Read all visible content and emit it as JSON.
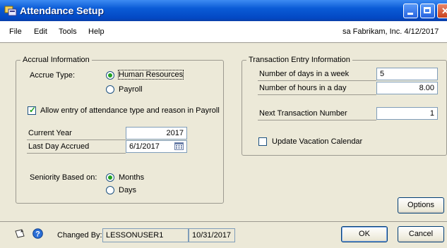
{
  "window": {
    "title": "Attendance Setup"
  },
  "menu": {
    "items": [
      "File",
      "Edit",
      "Tools",
      "Help"
    ],
    "company_info": "sa  Fabrikam, Inc.  4/12/2017"
  },
  "accrual": {
    "legend": "Accrual Information",
    "accrue_type_label": "Accrue Type:",
    "option_hr": "Human Resources",
    "option_payroll": "Payroll",
    "accrue_type_selected": "Human Resources",
    "allow_entry_label": "Allow entry of attendance type and reason in Payroll",
    "allow_entry_checked": true,
    "current_year_label": "Current Year",
    "current_year_value": "2017",
    "last_day_label": "Last Day Accrued",
    "last_day_value": "6/1/2017",
    "seniority_label": "Seniority Based on:",
    "option_months": "Months",
    "option_days": "Days",
    "seniority_selected": "Months"
  },
  "transaction": {
    "legend": "Transaction Entry Information",
    "days_week_label": "Number of days in a week",
    "days_week_value": "5",
    "hours_day_label": "Number of hours in a day",
    "hours_day_value": "8.00",
    "next_txn_label": "Next Transaction Number",
    "next_txn_value": "1",
    "update_vacation_label": "Update Vacation Calendar",
    "update_vacation_checked": false
  },
  "footer": {
    "options_button": "Options",
    "changed_by_label": "Changed By:",
    "changed_by_user": "LESSONUSER1",
    "changed_by_date": "10/31/2017",
    "ok_button": "OK",
    "cancel_button": "Cancel"
  },
  "colors": {
    "titlebar": "#0a5bd6",
    "window_bg": "#ece9d8",
    "field_border": "#7f9db9",
    "radio_dot": "#21a121"
  },
  "icons": [
    "window-app-icon",
    "minimize-icon",
    "maximize-icon",
    "close-icon",
    "calendar-icon",
    "note-icon",
    "help-icon"
  ]
}
